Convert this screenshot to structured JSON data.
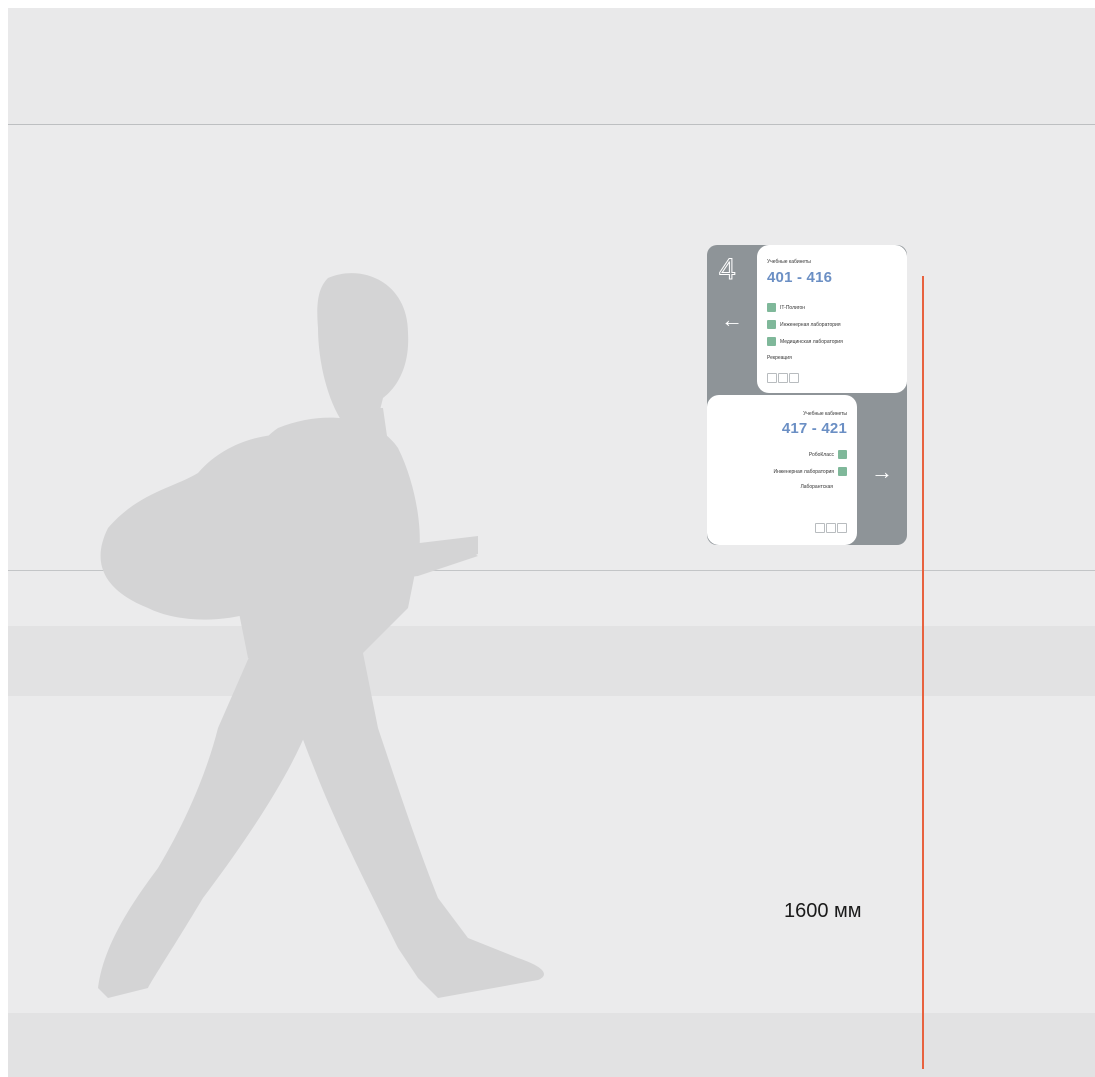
{
  "sign": {
    "floor": "4",
    "top": {
      "label": "Учебные кабинеты",
      "range": "401 - 416",
      "items": [
        "IT-Полигон",
        "Инженерная лаборатория",
        "Медицинская лаборатория"
      ],
      "extra": "Рекреация"
    },
    "bottom": {
      "label": "Учебные кабинеты",
      "range": "417 - 421",
      "items": [
        "РобоКласс",
        "Инженерная лаборатория"
      ],
      "extra": "Лаборантская"
    }
  },
  "measure": {
    "label": "1600 мм",
    "color": "#e8623f"
  },
  "colors": {
    "sign_gray": "#8e9498",
    "range_blue": "#6b8fc4",
    "icon_green": "#7fb89a"
  }
}
